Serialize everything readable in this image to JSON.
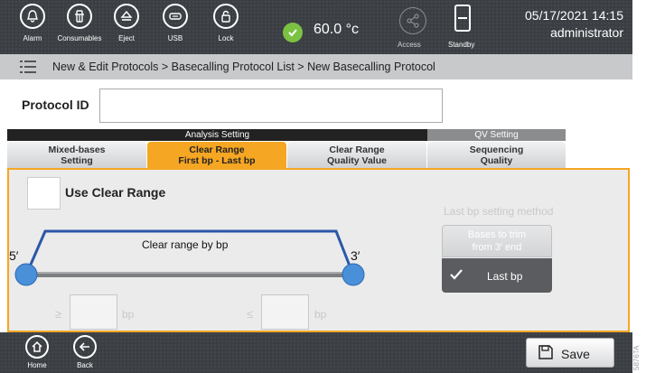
{
  "topbar": {
    "buttons": [
      {
        "label": "Alarm",
        "icon": "bell-icon"
      },
      {
        "label": "Consumables",
        "icon": "consumables-icon"
      },
      {
        "label": "Eject",
        "icon": "eject-icon"
      },
      {
        "label": "USB",
        "icon": "usb-icon"
      },
      {
        "label": "Lock",
        "icon": "lock-icon"
      }
    ],
    "temperature": "60.0 °c",
    "access_label": "Access",
    "standby_label": "Standby",
    "date": "05/17/2021 14:15",
    "user": "administrator",
    "status_color": "#7cc242"
  },
  "breadcrumb": "New & Edit Protocols > Basecalling Protocol List > New Basecalling Protocol",
  "protocol": {
    "label": "Protocol ID",
    "value": ""
  },
  "tabs": {
    "group_analysis": "Analysis Setting",
    "group_qv": "QV Setting",
    "items": [
      {
        "line1": "Mixed-bases",
        "line2": "Setting"
      },
      {
        "line1": "Clear Range",
        "line2": "First bp - Last bp"
      },
      {
        "line1": "Clear Range",
        "line2": "Quality Value"
      },
      {
        "line1": "Sequencing",
        "line2": "Quality"
      }
    ],
    "active_color": "#f5a623"
  },
  "panel": {
    "use_clear_range_label": "Use Clear Range",
    "diagram_label": "Clear range by bp",
    "five_prime": "5′",
    "three_prime": "3′",
    "ge_symbol": "≥",
    "le_symbol": "≤",
    "bp_unit": "bp",
    "min_bp_value": "",
    "max_bp_value": "",
    "method_title": "Last bp setting method",
    "method_option1_line1": "Bases to trim",
    "method_option1_line2": "from 3′ end",
    "method_option2": "Last bp"
  },
  "bottombar": {
    "home_label": "Home",
    "back_label": "Back",
    "save_label": "Save"
  },
  "figure_code": "5876TA"
}
